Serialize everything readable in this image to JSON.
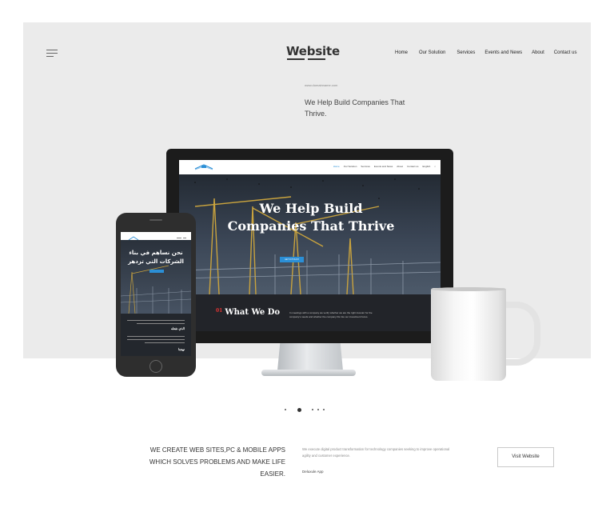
{
  "header": {
    "logo_text": "Website",
    "menu_icon": "hamburger-menu-icon",
    "nav_items": [
      "Home",
      "Our Solution",
      "Services",
      "Events and News",
      "About",
      "Contact us"
    ]
  },
  "hero": {
    "url_text": "www.domainname.com",
    "tagline": "We Help Build Companies That Thrive."
  },
  "monitor_mockup": {
    "nav_items": [
      "Home",
      "Our Solution",
      "Services",
      "Events and News",
      "About",
      "Contact us",
      "English"
    ],
    "hero_title": "We Help Build Companies That Thrive",
    "cta_label": "GET IN TOUCH",
    "section_number": "01",
    "section_title": "What We Do",
    "section_text": "In meetings with a company we verify whether we are the right investor for the company's needs and whether the company fits into our investment focus."
  },
  "phone_mockup": {
    "hero_title": "نحن نساهم في بناء الشركات التي تزدهر",
    "subheading_1": "الذي نفعله",
    "subheading_2": "نهجنا"
  },
  "carousel": {
    "count": 5,
    "active_index": 1
  },
  "project": {
    "heading": "WE CREATE WEB SITES,PC & MOBILE APPS WHICH SOLVES PROBLEMS AND MAKE LIFE EASIER.",
    "description": "We execute digital product transformation for technology companies seeking to improve operational agility and customer experience.",
    "app_name": "Deluxule App",
    "visit_button": "Visit Website"
  },
  "colors": {
    "hero_background": "#ebebeb",
    "accent_blue": "#2b8fd6",
    "accent_red": "#d33333",
    "dark_device": "#1c1c1c"
  }
}
